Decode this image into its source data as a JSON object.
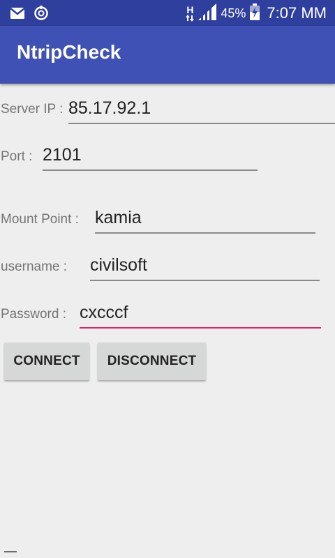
{
  "status_bar": {
    "network_type": "H",
    "battery": "45%",
    "time": "7:07 MM",
    "icons": [
      "gmail-icon",
      "sync-icon",
      "data-arrows-icon",
      "signal-icon",
      "battery-charging-icon"
    ]
  },
  "app_bar": {
    "title": "NtripCheck",
    "color": "#3f51b5"
  },
  "form": {
    "server_ip": {
      "label": "Server IP :",
      "value": "85.17.92.1"
    },
    "port": {
      "label": "Port :",
      "value": "2101"
    },
    "mount_point": {
      "label": "Mount Point :",
      "value": "kamia"
    },
    "username": {
      "label": "username :",
      "value": "civilsoft"
    },
    "password": {
      "label": "Password :",
      "value": "cxcccf"
    }
  },
  "buttons": {
    "connect": "CONNECT",
    "disconnect": "DISCONNECT"
  },
  "colors": {
    "accent": "#e91e63",
    "background": "#eeeeee",
    "status_bar": "#2f3f9e"
  }
}
